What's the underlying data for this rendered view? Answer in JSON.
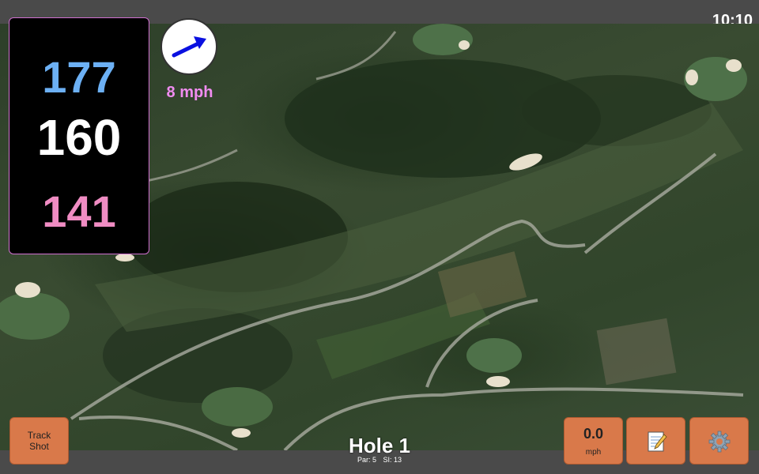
{
  "status_bar": {
    "time": "10:10"
  },
  "distances": {
    "back": "177",
    "middle": "160",
    "front": "141",
    "colors": {
      "back": "#6cb0f4",
      "middle": "#ffffff",
      "front": "#f08cc3"
    }
  },
  "wind": {
    "speed": "8 mph",
    "direction_icon": "arrow-icon"
  },
  "hole": {
    "title": "Hole 1",
    "par": "Par: 5",
    "si": "SI: 13"
  },
  "buttons": {
    "track_shot_line1": "Track",
    "track_shot_line2": "Shot",
    "speed_value": "0.0",
    "speed_unit": "mph",
    "notes_icon": "notepad-icon",
    "settings_icon": "gear-icon"
  },
  "colors": {
    "button": "#d9794a",
    "accent_border": "#d070d0"
  }
}
